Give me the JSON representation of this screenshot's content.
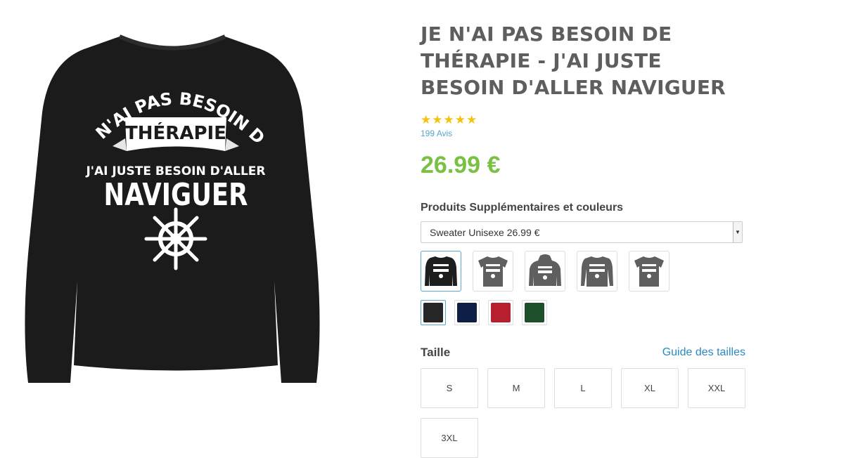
{
  "product": {
    "title": "JE N'AI PAS BESOIN DE THÉRAPIE - J'AI JUSTE BESOIN D'ALLER NAVIGUER",
    "rating_stars": "★★★★★",
    "reviews": "199 Avis",
    "price": "26.99 €"
  },
  "print": {
    "line1": "JE N'AI PAS BESOIN DE",
    "line2": "THÉRAPIE",
    "line3": "J'AI JUSTE BESOIN D'ALLER",
    "line4": "NAVIGUER"
  },
  "options": {
    "label": "Produits Supplémentaires et couleurs",
    "selected": "Sweater Unisexe 26.99 €",
    "thumbnails": [
      {
        "name": "sweater-black",
        "color": "#1e1e1e"
      },
      {
        "name": "tshirt-grey",
        "color": "#5f5f5f"
      },
      {
        "name": "hoodie-grey",
        "color": "#5f5f5f"
      },
      {
        "name": "longsleeve-grey",
        "color": "#5f5f5f"
      },
      {
        "name": "tshirt-grey-2",
        "color": "#5f5f5f"
      }
    ],
    "colors": [
      "#262626",
      "#0f1e46",
      "#b81f2e",
      "#1d4f2c"
    ]
  },
  "size": {
    "label": "Taille",
    "guide": "Guide des tailles",
    "options": [
      "S",
      "M",
      "L",
      "XL",
      "XXL",
      "3XL"
    ]
  }
}
